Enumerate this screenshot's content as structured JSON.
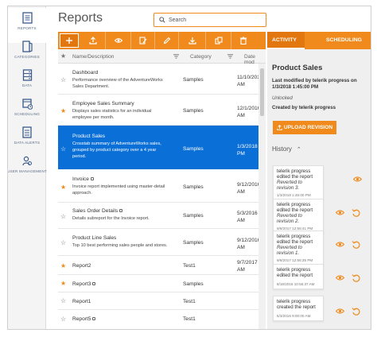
{
  "sidebar": {
    "items": [
      {
        "label": "REPORTS",
        "icon": "reports-icon"
      },
      {
        "label": "CATEGORIES",
        "icon": "categories-icon"
      },
      {
        "label": "DATA",
        "icon": "data-icon"
      },
      {
        "label": "SCHEDULING",
        "icon": "scheduling-icon"
      },
      {
        "label": "DATA ALERTS",
        "icon": "data-alerts-icon"
      },
      {
        "label": "USER MANAGEMENT",
        "icon": "user-management-icon"
      }
    ]
  },
  "header": {
    "title": "Reports",
    "search_placeholder": "Search"
  },
  "toolbar": {
    "buttons": [
      "add-icon",
      "upload-icon",
      "view-icon",
      "edit-definition-icon",
      "edit-icon",
      "download-icon",
      "copy-icon",
      "delete-icon"
    ]
  },
  "grid": {
    "columns": [
      "Name/Description",
      "Category",
      "Date mod"
    ],
    "rows": [
      {
        "starred": false,
        "name": "Dashboard",
        "desc": "Performance overview of the AdventureWorks Sales Department.",
        "category": "Samples",
        "date": "11/10/2016 AM",
        "locked": false
      },
      {
        "starred": true,
        "name": "Employee Sales Summary",
        "desc": "Displays sales statistics for an individual employee per month.",
        "category": "Samples",
        "date": "12/1/2016 AM",
        "locked": false
      },
      {
        "starred": false,
        "name": "Product Sales",
        "desc": "Crosstab summary of AdventureWorks sales, grouped by product category over a 4 year period.",
        "category": "Samples",
        "date": "1/3/2018 PM",
        "locked": false
      },
      {
        "starred": true,
        "name": "Invoice",
        "desc": "Invoice report implemented using master-detail approach.",
        "category": "Samples",
        "date": "9/12/2016 AM",
        "locked": true
      },
      {
        "starred": false,
        "name": "Sales Order Details",
        "desc": "Details subreport for the Invoice report.",
        "category": "Samples",
        "date": "5/3/2016 AM",
        "locked": true
      },
      {
        "starred": false,
        "name": "Product Line Sales",
        "desc": "Top 10 best performing sales people and stores.",
        "category": "Samples",
        "date": "9/12/2016 AM",
        "locked": false
      },
      {
        "starred": true,
        "name": "Report2",
        "desc": "",
        "category": "Test1",
        "date": "9/7/2017 AM",
        "locked": false
      },
      {
        "starred": true,
        "name": "Report3",
        "desc": "",
        "category": "Samples",
        "date": "",
        "locked": true
      },
      {
        "starred": false,
        "name": "Report1",
        "desc": "",
        "category": "Test1",
        "date": "",
        "locked": false
      },
      {
        "starred": false,
        "name": "Report5",
        "desc": "",
        "category": "Test1",
        "date": "",
        "locked": true
      }
    ]
  },
  "panel": {
    "tabs": [
      "ACTIVITY",
      "SCHEDULING"
    ],
    "title": "Product Sales",
    "modified_label": "Last modified by",
    "modified_text": "telerik progress on 1/3/2018 1:45:00 PM",
    "status": "Unlocked",
    "created": "Created by telerik progress",
    "upload_label": "UPLOAD REVISION",
    "history_label": "History",
    "history": [
      {
        "line1": "telerik progress edited the report",
        "line2": "Reverted to revision 3.",
        "ts": "1/3/2018 1:45:00 PM"
      },
      {
        "line1": "telerik progress edited the report",
        "line2": "Reverted to revision 2.",
        "ts": "9/8/2017 12:56:41 PM"
      },
      {
        "line1": "telerik progress edited the report",
        "line2": "Reverted to revision 1.",
        "ts": "9/8/2017 12:56:35 PM"
      },
      {
        "line1": "telerik progress edited the report",
        "line2": "",
        "ts": "8/18/2016 10:56:37 AM"
      },
      {
        "line1": "telerik progress created the report",
        "line2": "",
        "ts": "5/3/2016 9:00:00 AM"
      }
    ]
  },
  "colors": {
    "accent": "#f08a1c",
    "selected": "#0a6fd6",
    "nav_icon": "#3a5a8c"
  }
}
